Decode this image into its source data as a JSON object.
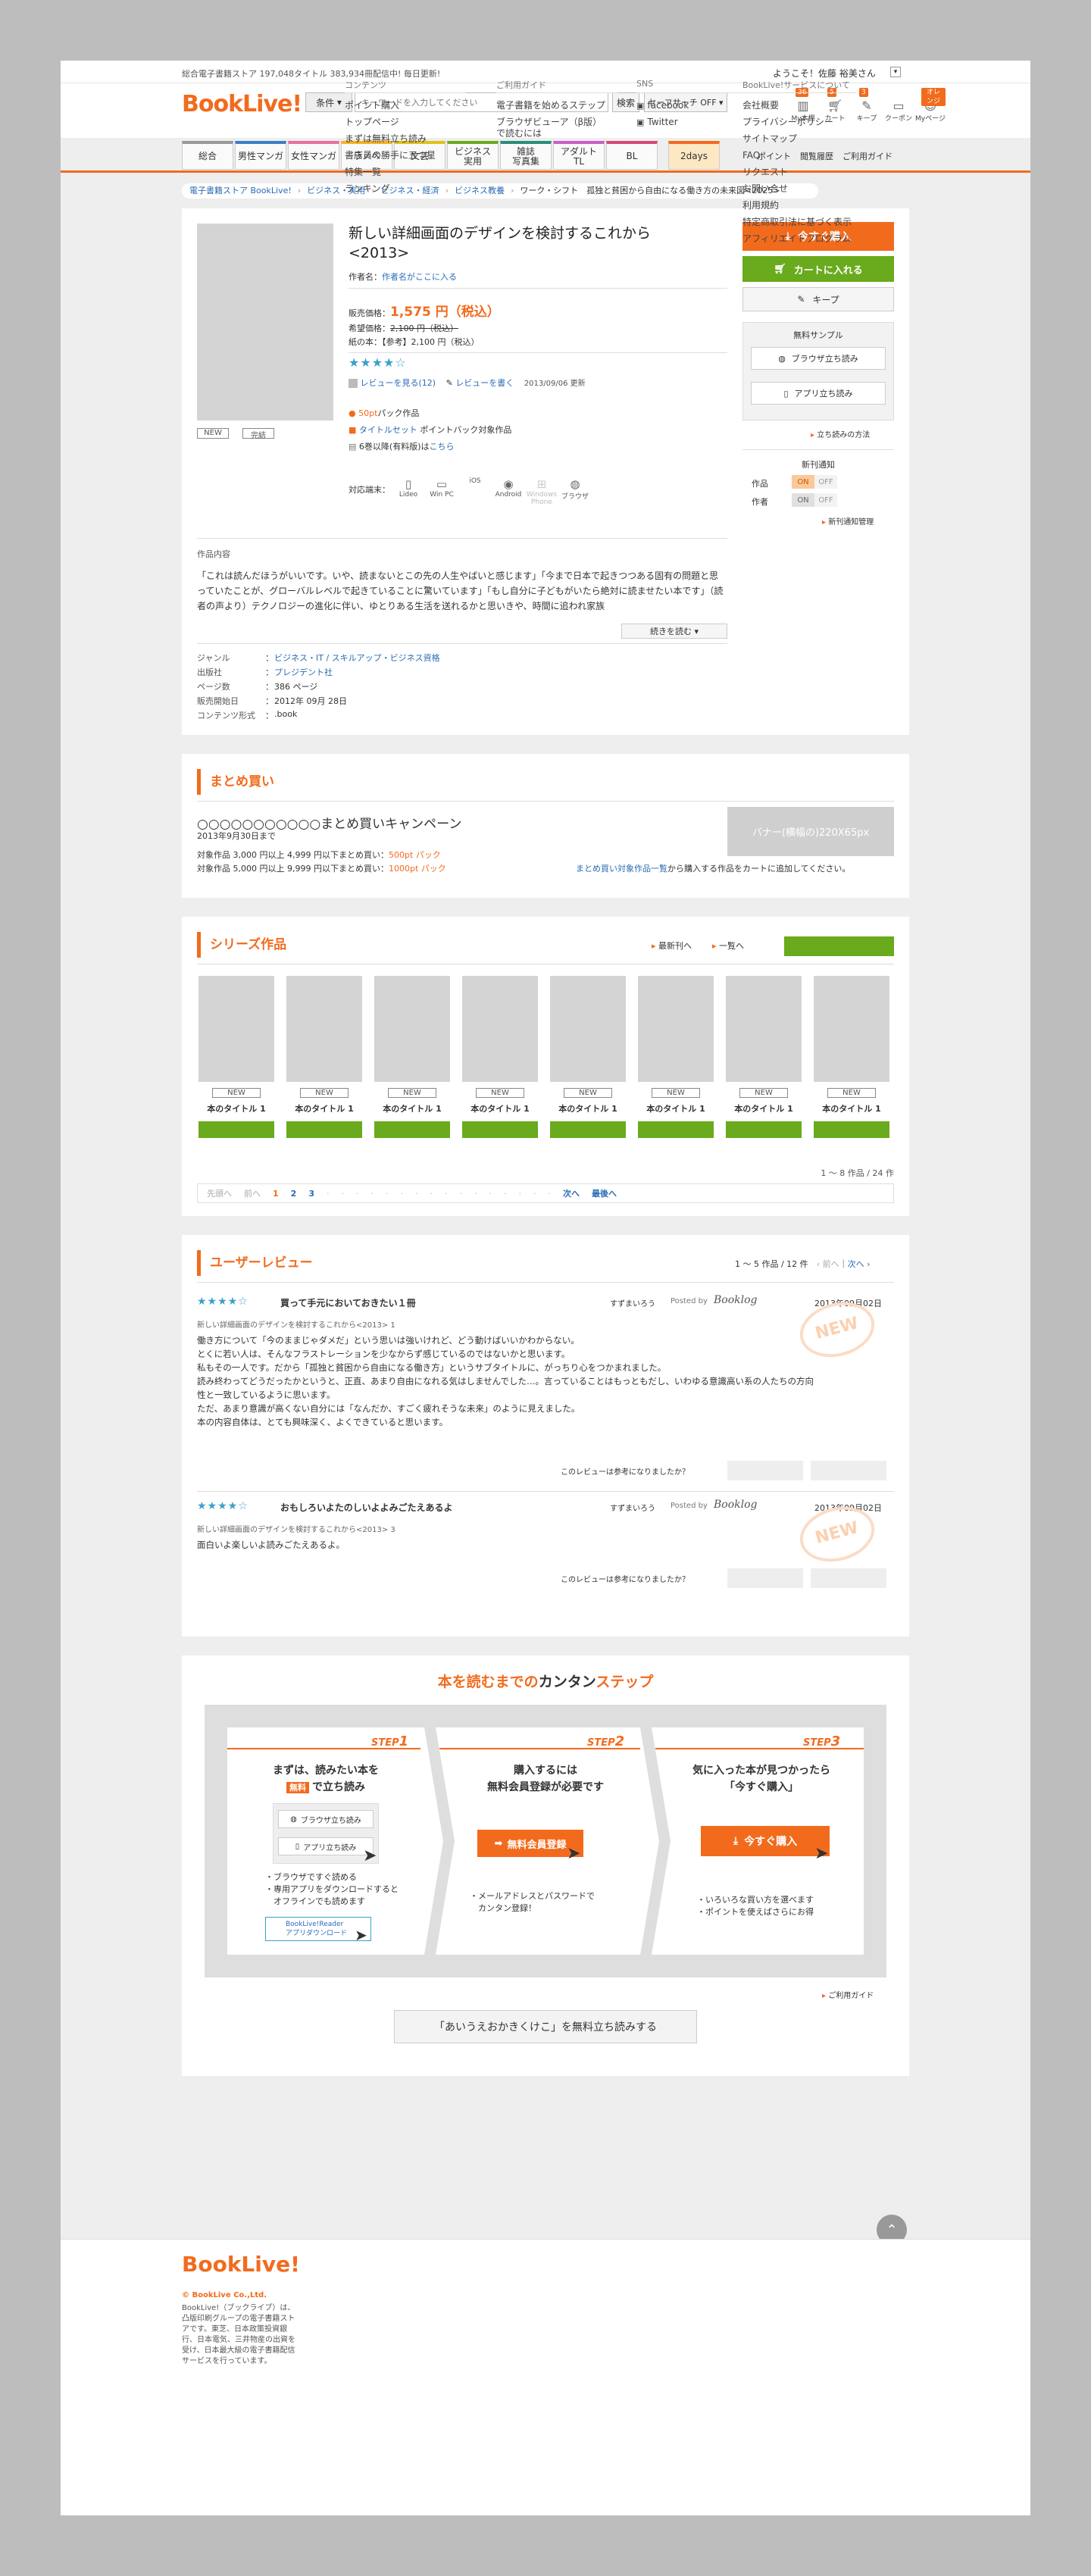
{
  "topbar": {
    "store_info": "総合電子書籍ストア 197,048タイトル 383,934冊配信中! 毎日更新!",
    "welcome": "ようこそ！佐藤 裕美さん"
  },
  "header": {
    "logo": "BookLive!",
    "condition_label": "条件",
    "search_placeholder": "キーワードを入力してください",
    "search_button": "検索",
    "safe_search": "セーフサーチ OFF",
    "icons": [
      {
        "label": "My本棚",
        "badge": "36",
        "icon": "bookshelf-icon"
      },
      {
        "label": "カート",
        "badge": "5",
        "icon": "cart-icon"
      },
      {
        "label": "キープ",
        "badge": "3",
        "icon": "keep-icon"
      },
      {
        "label": "クーポン",
        "badge": "",
        "icon": "coupon-icon"
      },
      {
        "label": "Myページ",
        "badge": "オレンジ",
        "icon": "user-icon"
      }
    ]
  },
  "nav": {
    "tabs": [
      "総合",
      "男性マンガ",
      "女性マンガ",
      "ラノベ",
      "文芸",
      "ビジネス\n実用",
      "雑誌\n写真集",
      "アダルト\nTL",
      "BL",
      "2days"
    ],
    "links": [
      "ポイント",
      "閲覧履歴",
      "ご利用ガイド"
    ]
  },
  "breadcrumb": [
    "電子書籍ストア BookLive!",
    "ビジネス・実用",
    "ビジネス・経済",
    "ビジネス教養",
    "ワーク・シフト　孤独と貧困から自由になる働き方の未来図<2025>"
  ],
  "product": {
    "title": "新しい詳細画面のデザインを検討するこれから<2013>",
    "author_label": "作者名：",
    "author": "作者名がここに入る",
    "price_label": "販売価格：",
    "price": "1,575 円（税込）",
    "list_price_label": "希望価格：",
    "list_price": "2,100 円（税込）",
    "paper_label": "紙の本：",
    "paper_price": "【参考】2,100 円（税込）",
    "stars": "★★★★☆",
    "review_link": "レビューを見る(12)",
    "review_write": "レビューを書く",
    "update": "2013/09/06 更新",
    "point_pack": "50pt",
    "point_pack_suffix": "パック作品",
    "title_set": "タイトルセット",
    "title_set_suffix": "ポイントバック対象作品",
    "volumes_prefix": "6巻以降(有料版)は",
    "volumes_link": "こちら",
    "tags": [
      "NEW",
      "完結"
    ],
    "devices_label": "対応端末：",
    "devices": [
      "Lideo",
      "Win PC",
      "iOS",
      "Android",
      "Windows Phone",
      "ブラウザ"
    ],
    "desc_label": "作品内容",
    "description": "「これは読んだほうがいいです。いや、読まないとこの先の人生やばいと感じます」「今まで日本で起きつつある固有の問題と思っていたことが、グローバルレベルで起きていることに驚いています」「もし自分に子どもがいたら絶対に読ませたい本です」（読者の声より）テクノロジーの進化に伴い、ゆとりある生活を送れるかと思いきや、時間に追われ家族",
    "read_more": "続きを読む",
    "meta": [
      {
        "k": "ジャンル",
        "v": "ビジネス・IT / スキルアップ・ビジネス資格",
        "link": true
      },
      {
        "k": "出版社",
        "v": "プレジデント社",
        "link": true
      },
      {
        "k": "ページ数",
        "v": "386 ページ",
        "link": false
      },
      {
        "k": "販売開始日",
        "v": "2012年 09月 28日",
        "link": false
      },
      {
        "k": "コンテンツ形式",
        "v": ".book",
        "link": false
      }
    ]
  },
  "side": {
    "buy": "今すぐ購入",
    "cart": "カートに入れる",
    "keep": "キープ",
    "sample_title": "無料サンプル",
    "browser_trial": "ブラウザ立ち読み",
    "app_trial": "アプリ立ち読み",
    "trial_howto": "立ち読みの方法",
    "notify_title": "新刊通知",
    "notify_rows": [
      {
        "label": "作品",
        "on": "ON",
        "off": "OFF"
      },
      {
        "label": "作者",
        "on": "ON",
        "off": "OFF"
      }
    ],
    "notify_manage": "新刊通知管理"
  },
  "bulk": {
    "title": "まとめ買い",
    "campaign": "○○○○○○○○○○○まとめ買いキャンペーン",
    "until": "2013年9月30日まで",
    "line1_prefix": "対象作品 3,000 円以上 4,999 円以下まとめ買い：",
    "line1_pack": "500pt パック",
    "line2_prefix": "対象作品 5,000 円以上 9,999 円以下まとめ買い：",
    "line2_pack": "1000pt パック",
    "link": "まとめ買い対象作品一覧",
    "link_suffix": "から購入する作品をカートに追加してください。",
    "banner": "バナー(横幅の)220X65px"
  },
  "series": {
    "title": "シリーズ作品",
    "latest": "最新刊へ",
    "list": "一覧へ",
    "books": [
      {
        "tag": "NEW",
        "title": "本のタイトル 1"
      },
      {
        "tag": "NEW",
        "title": "本のタイトル 1"
      },
      {
        "tag": "NEW",
        "title": "本のタイトル 1"
      },
      {
        "tag": "NEW",
        "title": "本のタイトル 1"
      },
      {
        "tag": "NEW",
        "title": "本のタイトル 1"
      },
      {
        "tag": "NEW",
        "title": "本のタイトル 1"
      },
      {
        "tag": "NEW",
        "title": "本のタイトル 1"
      },
      {
        "tag": "NEW",
        "title": "本のタイトル 1"
      }
    ],
    "count": "1 〜 8 作品 / 24 作",
    "pager": {
      "first": "先頭へ",
      "prev": "前へ",
      "pages": [
        "1",
        "2",
        "3"
      ],
      "next": "次へ",
      "last": "最後へ"
    }
  },
  "reviews": {
    "title": "ユーザーレビュー",
    "count": "1 〜 5 作品 / 12 件",
    "prev": "前へ",
    "next": "次へ",
    "items": [
      {
        "stars": "★★★★☆",
        "heading": "買って手元においておきたい１冊",
        "user": "すずまいろう",
        "posted_by": "Posted by",
        "site": "Booklog",
        "date": "2013年09月02日",
        "book": "新しい詳細画面のデザインを検討するこれから<2013> 1",
        "body": [
          "働き方について「今のままじゃダメだ」という思いは強いけれど、どう動けばいいかわからない。",
          "とくに若い人は、そんなフラストレーションを少なからず感じているのではないかと思います。",
          "私もその一人です。だから「孤独と貧困から自由になる働き方」というサブタイトルに、がっちり心をつかまれました。",
          "読み終わってどうだったかというと、正直、あまり自由になれる気はしませんでした…。言っていることはもっともだし、いわゆる意識高い系の人たちの方向性と一致しているように思います。",
          "ただ、あまり意識が高くない自分には「なんだか、すごく疲れそうな未来」のように見えました。",
          "本の内容自体は、とても興味深く、よくできていると思います。"
        ],
        "helpful": "このレビューは参考になりましたか？"
      },
      {
        "stars": "★★★★☆",
        "heading": "おもしろいよたのしいよよみごたえあるよ",
        "user": "すずまいろう",
        "posted_by": "Posted by",
        "site": "Booklog",
        "date": "2013年09月02日",
        "book": "新しい詳細画面のデザインを検討するこれから<2013> 3",
        "body": [
          "面白いよ楽しいよ読みごたえあるよ。"
        ],
        "helpful": "このレビューは参考になりましたか？"
      }
    ],
    "new_stamp": "NEW"
  },
  "steps": {
    "title_pre": "本を読むまでの",
    "title_mid": "カンタン",
    "title_post": "ステップ",
    "s1": {
      "label": "STEP",
      "num": "1",
      "head1": "まずは、読みたい本を",
      "free": "無料",
      "head2": "で立ち読み",
      "btn1": "ブラウザ立ち読み",
      "btn2": "アプリ立ち読み",
      "notes": [
        "・ブラウザですぐ読める",
        "・専用アプリをダウンロードすると",
        "　オフラインでも読めます"
      ],
      "dl": "BookLive!Reader\nアプリダウンロード"
    },
    "s2": {
      "label": "STEP",
      "num": "2",
      "head1": "購入するには",
      "head2": "無料会員登録が必要です",
      "btn": "無料会員登録",
      "notes": [
        "・メールアドレスとパスワードで",
        "　カンタン登録！"
      ]
    },
    "s3": {
      "label": "STEP",
      "num": "3",
      "head1": "気に入った本が見つかったら",
      "head2": "「今すぐ購入」",
      "btn": "今すぐ購入",
      "notes": [
        "・いろいろな買い方を選べます",
        "・ポイントを使えばさらにお得"
      ]
    },
    "guide": "ご利用ガイド",
    "trial_button": "「あいうえおかきくけこ」を無料立ち読みする"
  },
  "footer": {
    "logo": "BookLive!",
    "copyright": "© BookLive Co.,Ltd.",
    "about": "BookLive!（ブックライブ）は、凸版印刷グループの電子書籍ストアです。東芝、日本政策投資銀行、日本電気、三井物産の出資を受け、日本最大級の電子書籍配信サービスを行っています。",
    "cols": [
      {
        "title": "コンテンツ",
        "items": [
          "ポイント購入",
          "トップページ",
          "まずは無料立ち読み",
          "書店員の勝手に五つ星",
          "特集一覧",
          "ランキング"
        ]
      },
      {
        "title": "ご利用ガイド",
        "items": [
          "電子書籍を始めるステップ",
          "ブラウザビューア（β版）で読むには"
        ]
      },
      {
        "title": "SNS",
        "items": [
          "facebook",
          "Twitter"
        ]
      },
      {
        "title": "BookLive!サービスについて",
        "items": [
          "会社概要",
          "プライバシーポリシー",
          "サイトマップ",
          "FAQ",
          "リクエスト",
          "お問い合せ",
          "利用規約",
          "特定商取引法に基づく表示",
          "アフィリエイトプログラム"
        ]
      }
    ]
  },
  "colors": {
    "accent": "#f26b1d",
    "green": "#6aaa1d",
    "link": "#2a6bb5",
    "star": "#3aa0c8"
  }
}
